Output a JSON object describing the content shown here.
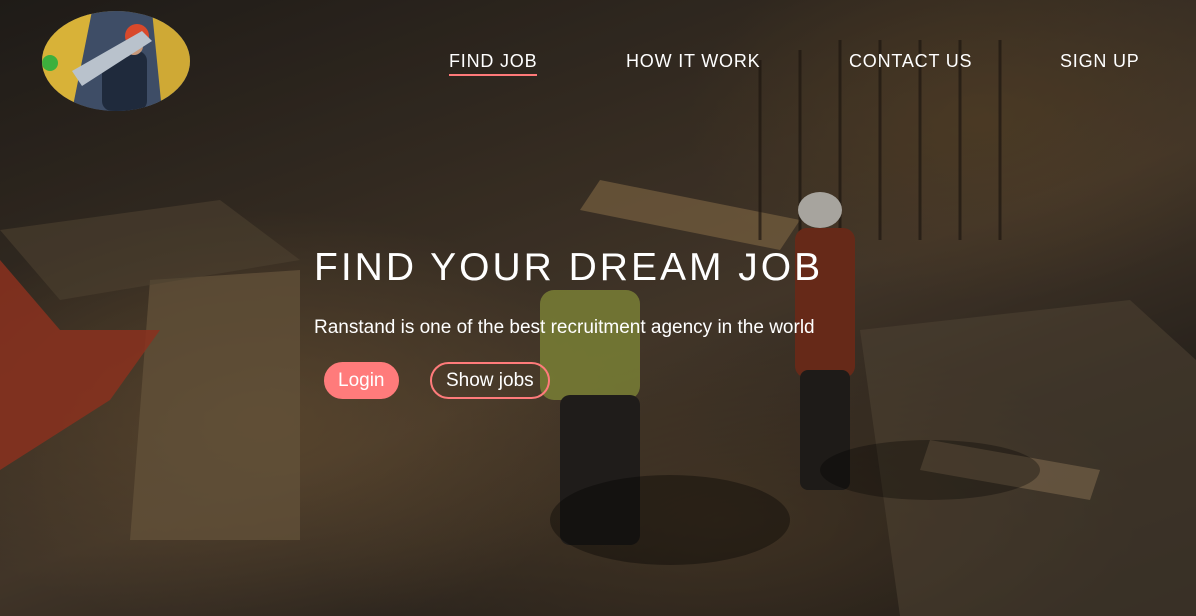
{
  "nav": {
    "items": [
      {
        "label": "FIND JOB",
        "active": true
      },
      {
        "label": "HOW IT WORK",
        "active": false
      },
      {
        "label": "CONTACT US",
        "active": false
      },
      {
        "label": "SIGN UP",
        "active": false
      }
    ]
  },
  "hero": {
    "title": "FIND YOUR DREAM JOB",
    "subtitle": "Ranstand is one of the best recruitment agency in the world",
    "login_label": "Login",
    "show_jobs_label": "Show jobs"
  },
  "colors": {
    "accent": "#ff7b7b",
    "text": "#ffffff"
  },
  "icons": {
    "logo": "construction-worker-logo",
    "background": "construction-site-photo"
  }
}
